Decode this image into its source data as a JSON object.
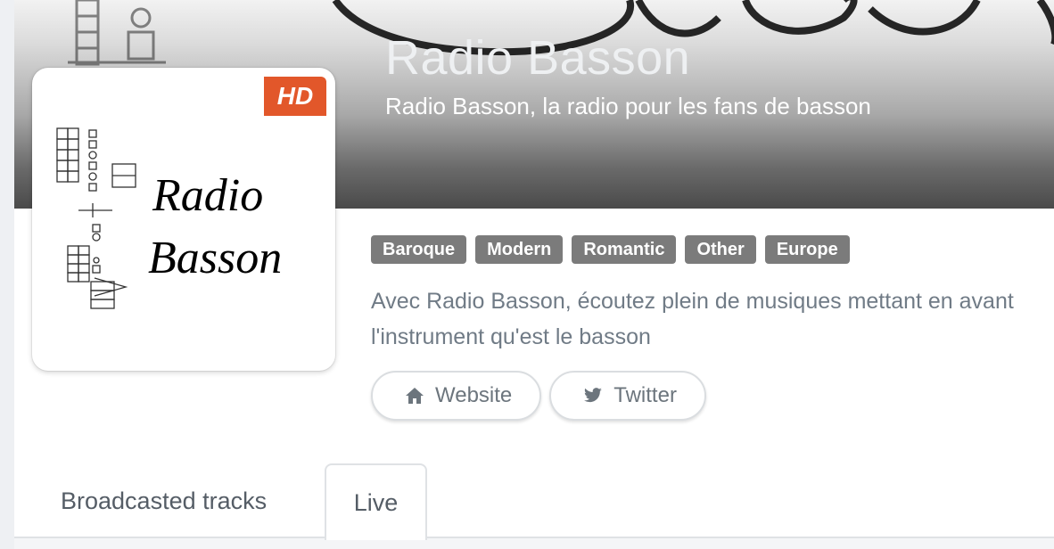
{
  "station": {
    "title": "Radio Basson",
    "subtitle": "Radio Basson, la radio pour les fans de basson",
    "badge": "HD",
    "logo_text": [
      "Radio",
      "Basson"
    ]
  },
  "tags": [
    "Baroque",
    "Modern",
    "Romantic",
    "Other",
    "Europe"
  ],
  "description": "Avec Radio Basson, écoutez plein de musiques mettant en avant l'instrument qu'est le basson",
  "links": {
    "website": {
      "label": "Website",
      "icon": "home-icon"
    },
    "twitter": {
      "label": "Twitter",
      "icon": "twitter-icon"
    }
  },
  "tabs": [
    {
      "label": "Broadcasted tracks",
      "active": false
    },
    {
      "label": "Live",
      "active": true
    }
  ],
  "colors": {
    "badge": "#e2572a",
    "tag": "#7b7b7b",
    "text_muted": "#707b86"
  }
}
